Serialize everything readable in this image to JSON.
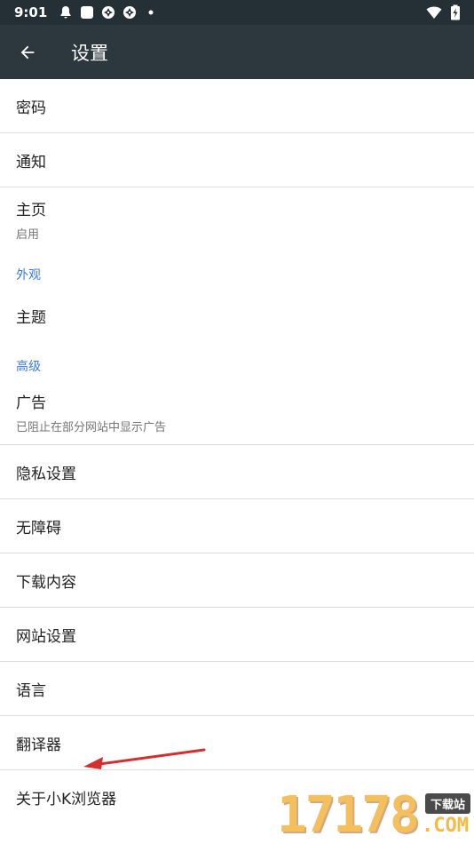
{
  "statusbar": {
    "time": "9:01",
    "icons": [
      "notification-icon",
      "square-app-icon",
      "aperture-icon",
      "aperture-icon",
      "dot-icon"
    ],
    "right_icons": [
      "wifi-icon",
      "battery-charging-icon"
    ]
  },
  "toolbar": {
    "back_icon": "arrow-left-icon",
    "title": "设置"
  },
  "items": {
    "password": "密码",
    "notifications": "通知",
    "homepage": {
      "title": "主页",
      "subtitle": "启用"
    },
    "section_appearance": "外观",
    "theme": "主题",
    "section_advanced": "高级",
    "ads": {
      "title": "广告",
      "subtitle": "已阻止在部分网站中显示广告"
    },
    "privacy": "隐私设置",
    "accessibility": "无障碍",
    "downloads": "下载内容",
    "site_settings": "网站设置",
    "language": "语言",
    "translator": "翻译器",
    "about": "关于小K浏览器"
  },
  "watermark": {
    "number": "17178",
    "tag": "下载站",
    "domain": ".COM"
  },
  "colors": {
    "statusbar": "#243036",
    "toolbar": "#2c383e",
    "section_header": "#3a7bd5",
    "arrow": "#d32f2f",
    "watermark": "#f5b94a"
  }
}
